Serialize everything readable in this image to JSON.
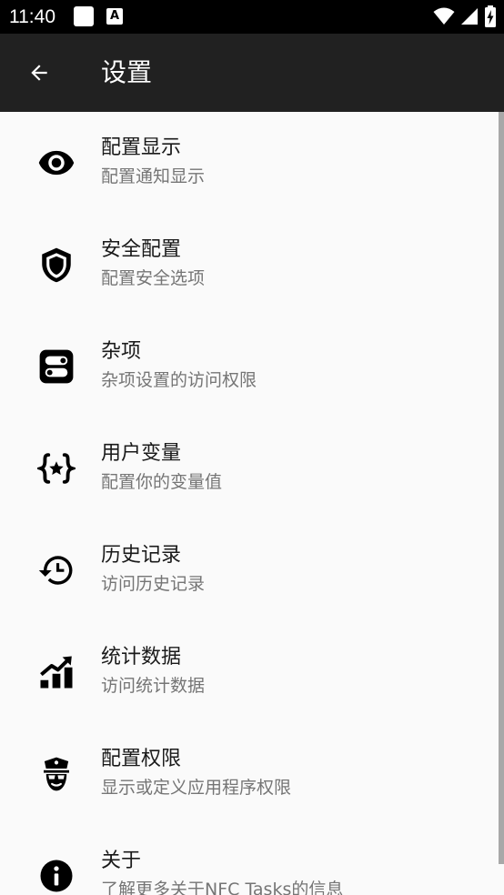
{
  "status_bar": {
    "time": "11:40",
    "notification_icons": [
      "square-icon",
      "a-box-icon"
    ],
    "a_glyph": "A",
    "system_icons": [
      "wifi-icon",
      "cellular-icon",
      "battery-charging-icon"
    ]
  },
  "app_bar": {
    "title": "设置",
    "back_icon": "arrow-back-icon",
    "background": "#212121"
  },
  "settings": {
    "items": [
      {
        "icon": "eye-icon",
        "title": "配置显示",
        "subtitle": "配置通知显示"
      },
      {
        "icon": "shield-icon",
        "title": "安全配置",
        "subtitle": "配置安全选项"
      },
      {
        "icon": "toggles-icon",
        "title": "杂项",
        "subtitle": "杂项设置的访问权限"
      },
      {
        "icon": "variable-icon",
        "title": "用户变量",
        "subtitle": "配置你的变量值"
      },
      {
        "icon": "history-icon",
        "title": "历史记录",
        "subtitle": "访问历史记录"
      },
      {
        "icon": "chart-icon",
        "title": "统计数据",
        "subtitle": "访问统计数据"
      },
      {
        "icon": "police-icon",
        "title": "配置权限",
        "subtitle": "显示或定义应用程序权限"
      },
      {
        "icon": "info-icon",
        "title": "关于",
        "subtitle": "了解更多关于NFC Tasks的信息"
      }
    ]
  },
  "colors": {
    "background": "#fafafa",
    "title_text": "#1a1a1a",
    "subtitle_text": "#757575",
    "status_bar": "#000000"
  }
}
